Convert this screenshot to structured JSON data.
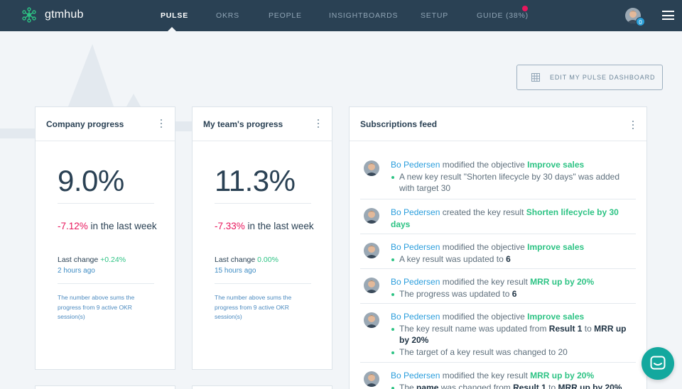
{
  "app": {
    "name": "gtmhub"
  },
  "nav": {
    "items": [
      {
        "label": "PULSE",
        "active": true
      },
      {
        "label": "OKRS",
        "active": false
      },
      {
        "label": "PEOPLE",
        "active": false
      },
      {
        "label": "INSIGHTBOARDS",
        "active": false
      },
      {
        "label": "SETUP",
        "active": false
      },
      {
        "label": "GUIDE (38%)",
        "active": false
      }
    ],
    "notification_count": "0"
  },
  "toolbar": {
    "edit_dashboard_label": "EDIT MY PULSE DASHBOARD"
  },
  "company_progress": {
    "title": "Company progress",
    "value": "9.0%",
    "weekly_change": "-7.12%",
    "weekly_suffix": " in the last week",
    "last_change_label": "Last change ",
    "last_change_value": "+0.24%",
    "last_change_ago": "2 hours ago",
    "note": "The number above sums the progress from 9 active OKR session(s)"
  },
  "team_progress": {
    "title": "My team's progress",
    "value": "11.3%",
    "weekly_change": "-7.33%",
    "weekly_suffix": " in the last week",
    "last_change_label": "Last change ",
    "last_change_value": "0.00%",
    "last_change_ago": "15 hours ago",
    "note": "The number above sums the progress from 9 active OKR session(s)"
  },
  "feed": {
    "title": "Subscriptions feed",
    "items": [
      {
        "who": "Bo Pedersen",
        "action": " modified the objective ",
        "target": "Improve sales",
        "detail": "A new key result \"Shorten lifecycle by 30 days\" was added with target 30"
      },
      {
        "who": "Bo Pedersen",
        "action": " created the key result ",
        "target": "Shorten lifecycle by 30 days"
      },
      {
        "who": "Bo Pedersen",
        "action": " modified the objective ",
        "target": "Improve sales",
        "detail_prefix": "A key result was updated to ",
        "detail_value": "6"
      },
      {
        "who": "Bo Pedersen",
        "action": " modified the key result ",
        "target": "MRR up by 20%",
        "detail_prefix": "The progress was updated to ",
        "detail_value": "6"
      },
      {
        "who": "Bo Pedersen",
        "action": " modified the objective ",
        "target": "Improve sales",
        "detail_a_prefix": "The key result name was updated from ",
        "detail_a_from": "Result 1",
        "detail_a_mid": " to ",
        "detail_a_to": "MRR up by 20%",
        "detail_b": "The target of a key result was changed to 20"
      },
      {
        "who": "Bo Pedersen",
        "action": " modified the key result ",
        "target": "MRR up by 20%",
        "detail_p1": "The ",
        "detail_p2": "name",
        "detail_p3": " was changed from ",
        "detail_p4": "Result 1",
        "detail_p5": " to ",
        "detail_p6": "MRR up by 20%"
      }
    ]
  },
  "colors": {
    "topbar": "#2a4154",
    "accent_green": "#2dc384",
    "negative_red": "#e8175d",
    "link_blue": "#2a9ddc",
    "chat": "#13a89e"
  },
  "icons": {
    "logo": "gtmhub-molecule-icon",
    "edit": "grid-icon",
    "menu": "hamburger-icon",
    "chat": "chat-bubble-icon"
  }
}
